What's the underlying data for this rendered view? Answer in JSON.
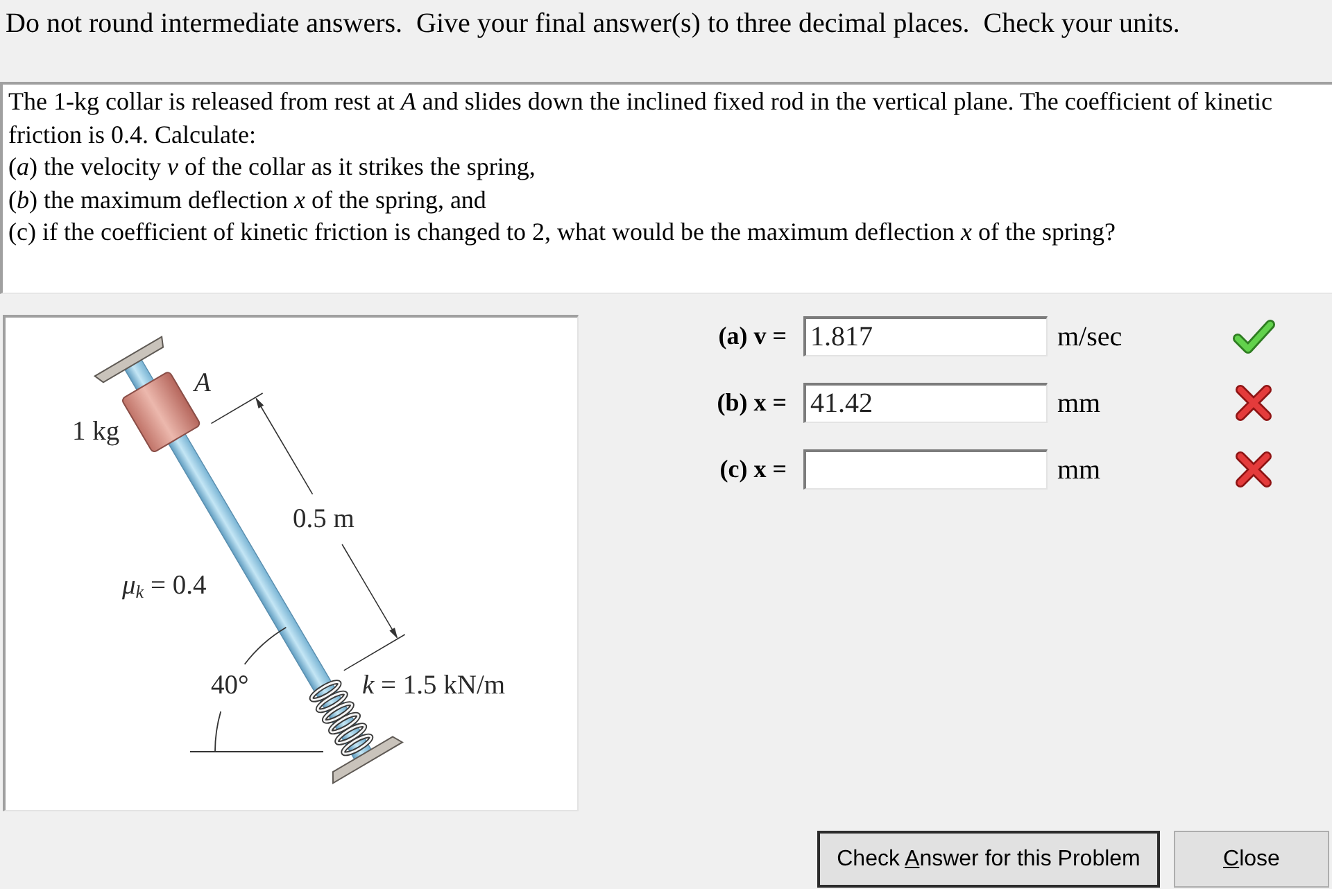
{
  "instructions": "Do not round intermediate answers.  Give your final answer(s) to three decimal places.  Check your units.",
  "problem": {
    "intro": "The 1-kg collar is released from rest at *A* and slides down the inclined fixed rod in the vertical plane. The coefficient of kinetic friction is 0.4. Calculate:",
    "parts": [
      "(*a*) the velocity *v* of the collar as it strikes the spring,",
      "(*b*) the maximum deflection *x* of the spring, and",
      "(c) if the coefficient of kinetic friction is changed to 2, what would be the maximum deflection *x* of the spring?"
    ]
  },
  "diagram": {
    "labels": {
      "point_label": "A",
      "mass": "1 kg",
      "length": "0.5 m",
      "friction": "*μ*$_{k}$ = 0.4",
      "angle": "40°",
      "stiffness": "*k* = 1.5 kN/m"
    }
  },
  "answers": [
    {
      "label": "(a) v =",
      "value": "1.817",
      "unit": "m/sec",
      "correct": true
    },
    {
      "label": "(b) x =",
      "value": "41.42",
      "unit": "mm",
      "correct": false
    },
    {
      "label": "(c) x =",
      "unit": "mm",
      "correct": false
    }
  ],
  "buttons": [
    {
      "label_start": "Check ",
      "access_key": "A",
      "label_end": "nswer for this Problem",
      "default": true
    },
    {
      "access_key": "C",
      "label_end": "lose",
      "default": false
    }
  ]
}
